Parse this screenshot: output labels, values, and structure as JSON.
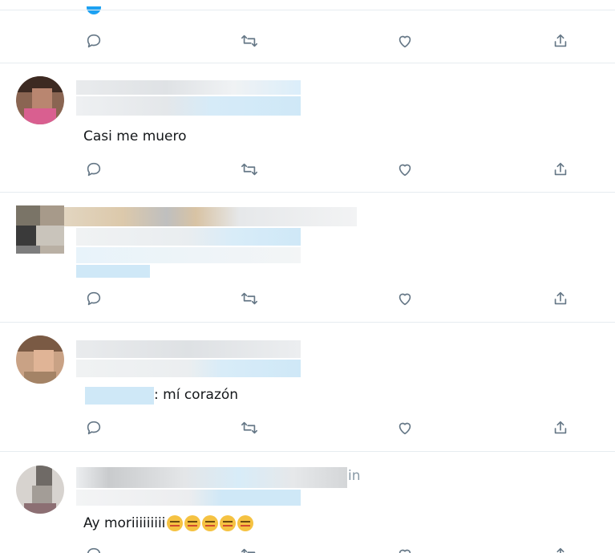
{
  "tweets": [
    {
      "text": ""
    },
    {
      "text": "Casi me muero"
    },
    {
      "text": ""
    },
    {
      "text": ": mí corazón"
    },
    {
      "time_fragment": "in",
      "text": "Ay moriiiiiiiii"
    }
  ],
  "actions": {
    "reply": "reply-icon",
    "retweet": "retweet-icon",
    "like": "heart-icon",
    "share": "share-icon"
  },
  "colors": {
    "icon": "#657786",
    "separator": "#e6ecf0",
    "link_blur": "#cfe8f7",
    "accent": "#1da1f2"
  }
}
